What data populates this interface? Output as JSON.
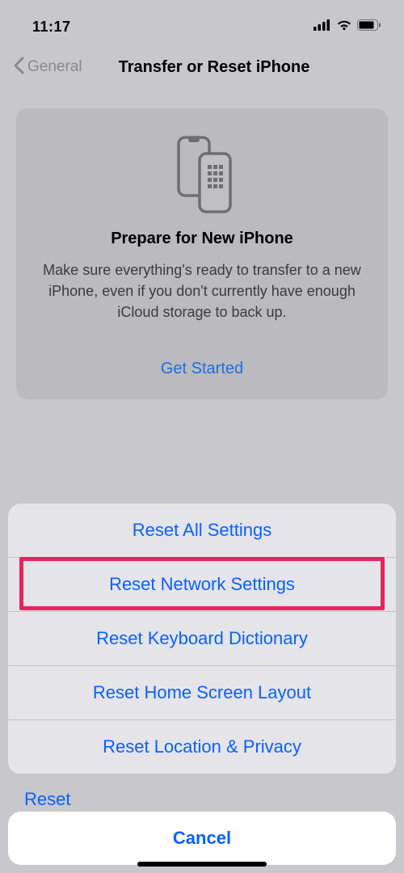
{
  "status": {
    "time": "11:17"
  },
  "nav": {
    "back_label": "General",
    "title": "Transfer or Reset iPhone"
  },
  "card": {
    "title": "Prepare for New iPhone",
    "body": "Make sure everything's ready to transfer to a new iPhone, even if you don't currently have enough iCloud storage to back up.",
    "cta": "Get Started"
  },
  "sheet": {
    "options": [
      "Reset All Settings",
      "Reset Network Settings",
      "Reset Keyboard Dictionary",
      "Reset Home Screen Layout",
      "Reset Location & Privacy"
    ],
    "highlight_index": 1,
    "fragment": "Reset",
    "cancel": "Cancel"
  }
}
